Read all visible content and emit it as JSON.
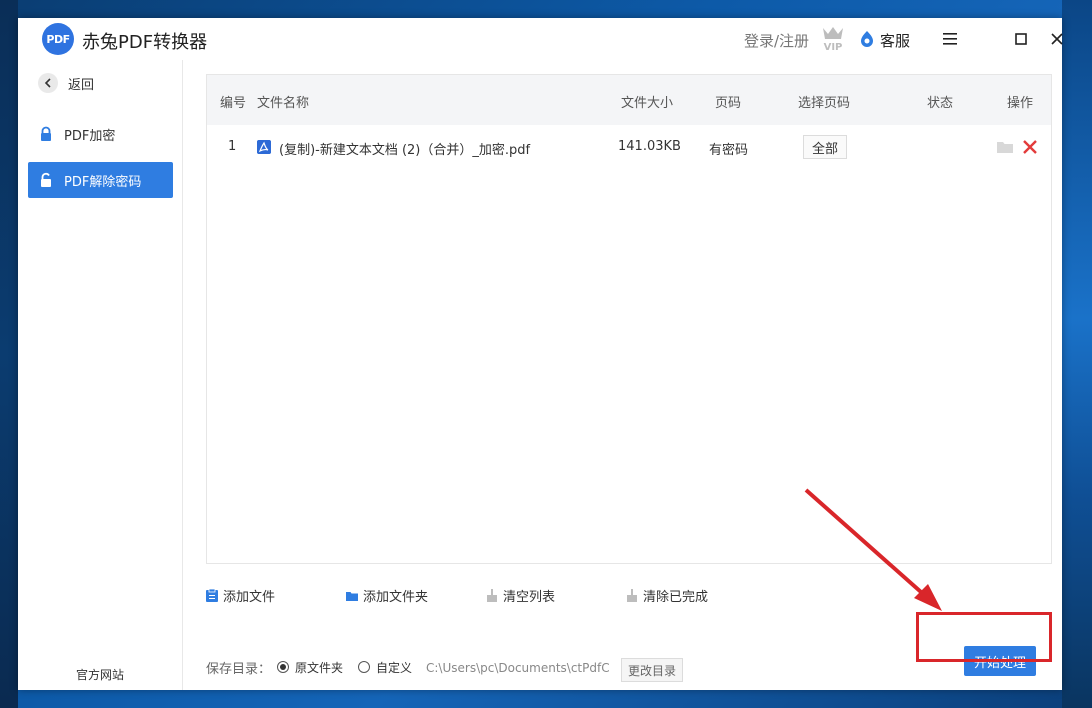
{
  "app": {
    "logo_text": "PDF",
    "title": "赤兔PDF转换器",
    "login": "登录/注册",
    "service": "客服"
  },
  "sidebar": {
    "back_label": "返回",
    "items": [
      {
        "label": "PDF加密",
        "active": false
      },
      {
        "label": "PDF解除密码",
        "active": true
      }
    ],
    "footer": "官方网站"
  },
  "table": {
    "headers": [
      "编号",
      "文件名称",
      "文件大小",
      "页码",
      "选择页码",
      "状态",
      "操作"
    ],
    "rows": [
      {
        "index": "1",
        "name": "(复制)-新建文本文档 (2)（合并）_加密.pdf",
        "size": "141.03KB",
        "pages": "有密码",
        "select": "全部",
        "status": ""
      }
    ]
  },
  "toolbar": {
    "add_file": "添加文件",
    "add_folder": "添加文件夹",
    "clear_list": "清空列表",
    "clear_done": "清除已完成"
  },
  "save": {
    "label": "保存目录：",
    "option_original": "原文件夹",
    "option_custom": "自定义",
    "path": "C:\\Users\\pc\\Documents\\ctPdfCo",
    "change_button": "更改目录"
  },
  "start_button": "开始处理",
  "colors": {
    "accent": "#2f7de1",
    "annotation": "#d9262a",
    "delete": "#e33b3b"
  }
}
